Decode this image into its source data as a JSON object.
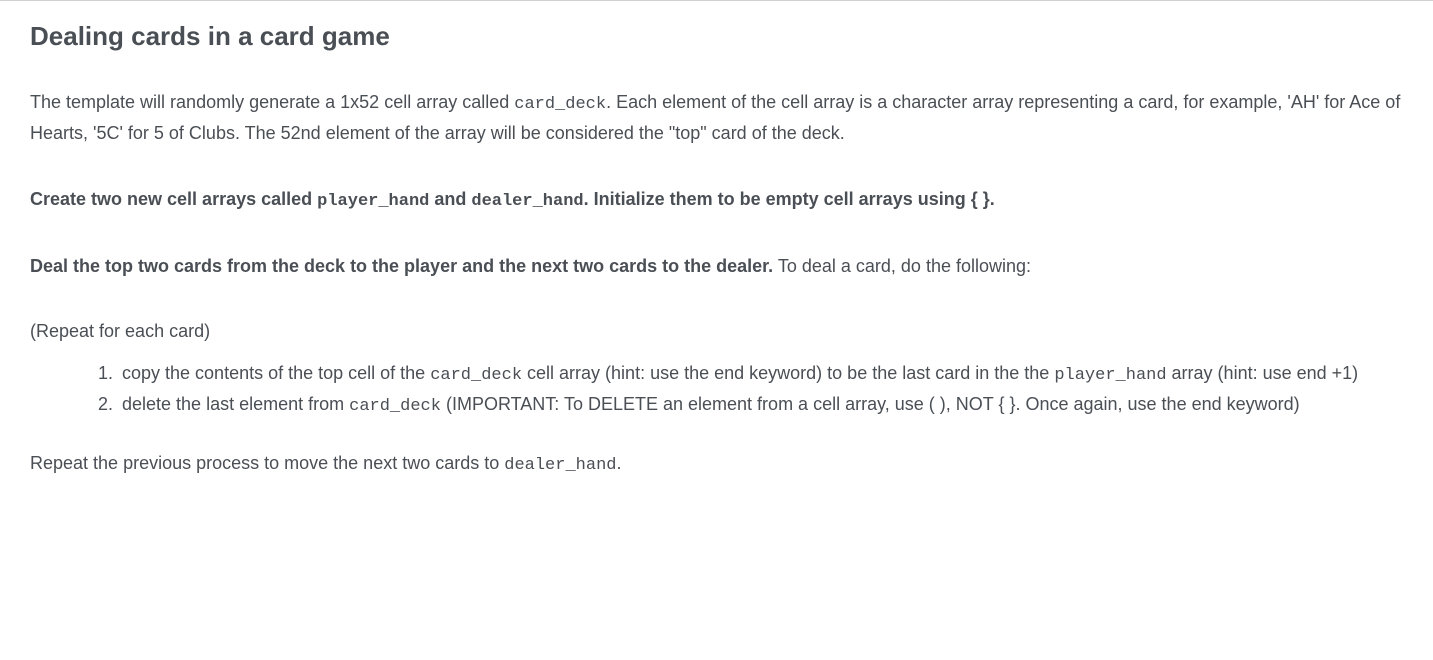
{
  "title": "Dealing cards in a card game",
  "para1": {
    "t1": "The template will randomly generate a 1x52 cell array called ",
    "code1": "card_deck",
    "t2": ". Each element of the cell array is a character array representing a card, for example, 'AH' for Ace of Hearts, '5C' for 5 of Clubs. The 52nd element of the array will be considered the \"top\" card of the deck."
  },
  "para2": {
    "b1": "Create two new cell arrays called ",
    "c1": "player_hand",
    "b2": " and ",
    "c2": "dealer_hand",
    "b3": ". Initialize them to be empty cell arrays using { }."
  },
  "para3": {
    "b1": "Deal the top two cards from the deck to the player and the next two cards to the dealer.",
    "t1": " To deal a card, do the following:"
  },
  "para4": "(Repeat for each card)",
  "list": {
    "item1": {
      "t1": "copy the contents of the top cell of the ",
      "c1": "card_deck",
      "t2": " cell array (hint: use the end keyword) to be the last card in the the ",
      "c2": "player_hand",
      "t3": " array (hint: use end +1)"
    },
    "item2": {
      "t1": "delete the last element from ",
      "c1": "card_deck",
      "t2": " (IMPORTANT: To DELETE an element from a cell array, use ( ), NOT { }. Once again, use the end keyword)"
    }
  },
  "para5": {
    "t1": "Repeat the previous process to move the next two cards to ",
    "c1": "dealer_hand",
    "t2": "."
  }
}
